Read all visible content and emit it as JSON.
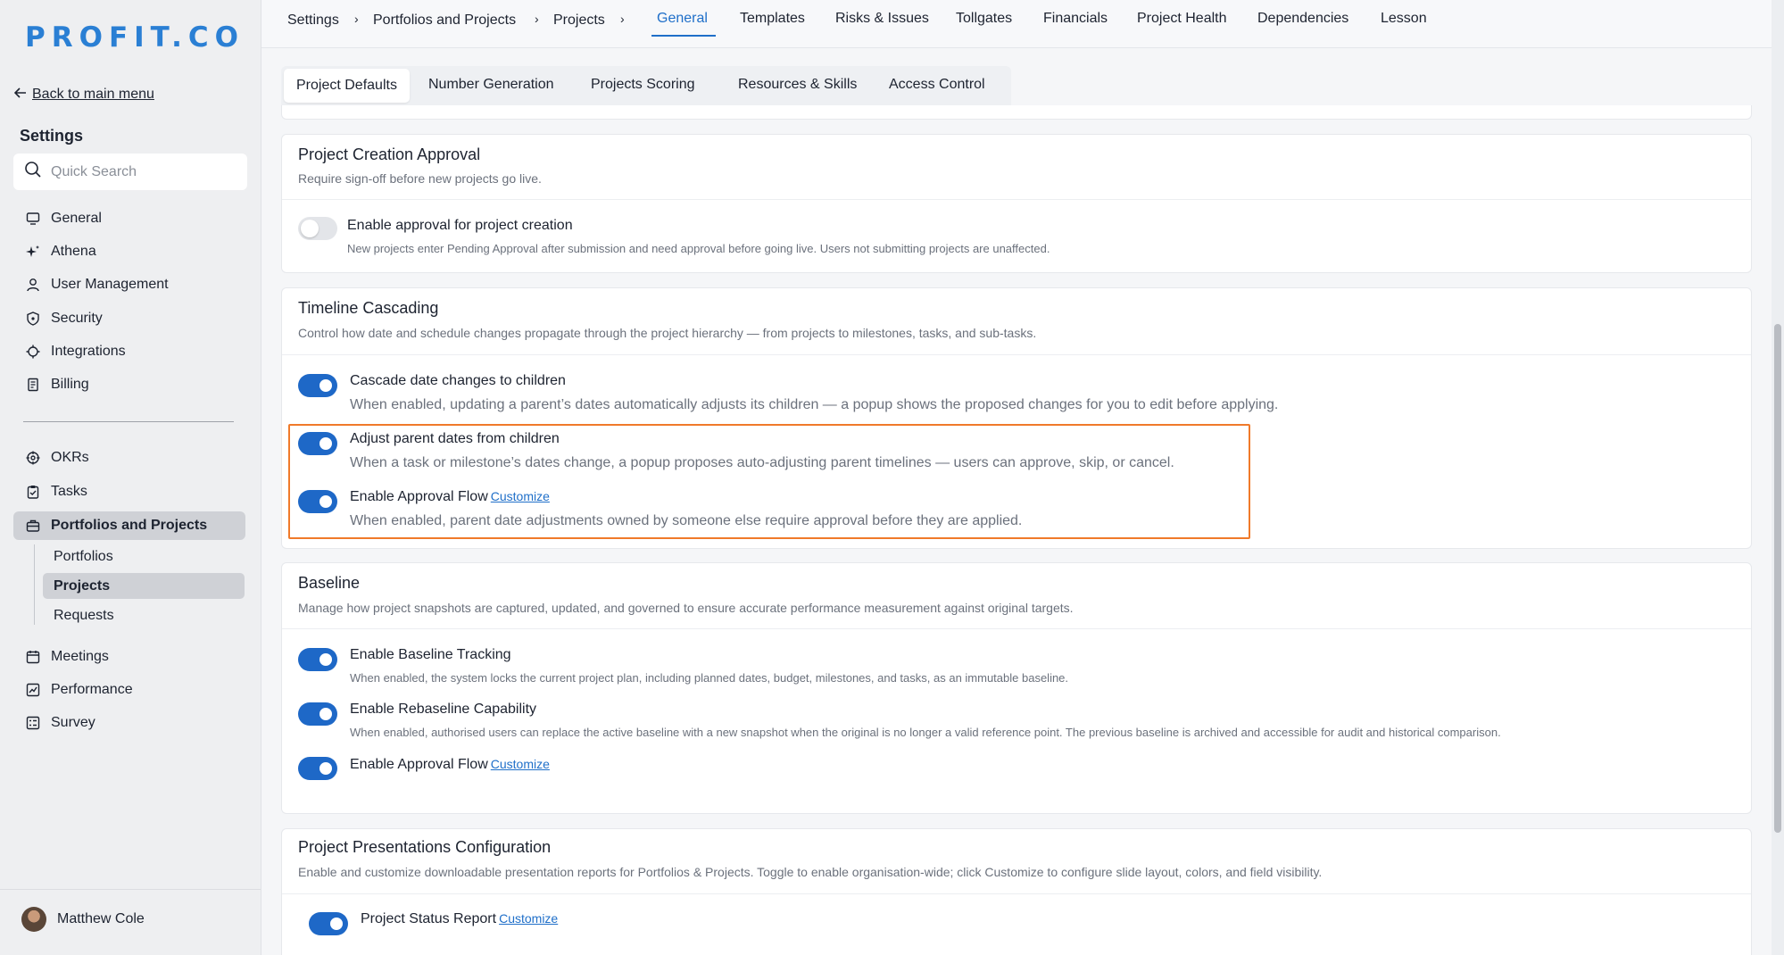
{
  "logo": {
    "text": "PROFIT.CO",
    "color": "#2a7fd4"
  },
  "sidebar": {
    "back_label": "Back to main menu",
    "heading": "Settings",
    "search": {
      "placeholder": "Quick Search",
      "value": ""
    },
    "items_top": [
      {
        "label": "General",
        "icon": "monitor-icon"
      },
      {
        "label": "Athena",
        "icon": "sparkle-icon"
      },
      {
        "label": "User Management",
        "icon": "user-icon"
      },
      {
        "label": "Security",
        "icon": "shield-icon"
      },
      {
        "label": "Integrations",
        "icon": "gear-icon"
      },
      {
        "label": "Billing",
        "icon": "receipt-icon"
      }
    ],
    "items_bottom": [
      {
        "label": "OKRs",
        "icon": "target-icon"
      },
      {
        "label": "Tasks",
        "icon": "clipboard-check-icon"
      },
      {
        "label": "Portfolios and Projects",
        "icon": "briefcase-icon"
      }
    ],
    "sub_items": [
      "Portfolios",
      "Projects",
      "Requests"
    ],
    "items_after": [
      {
        "label": "Meetings",
        "icon": "calendar-icon"
      },
      {
        "label": "Performance",
        "icon": "chart-icon"
      },
      {
        "label": "Survey",
        "icon": "survey-icon"
      }
    ],
    "user_name": "Matthew Cole"
  },
  "breadcrumb": [
    "Settings",
    "Portfolios and Projects",
    "Projects"
  ],
  "top_tabs": [
    "General",
    "Templates",
    "Risks & Issues",
    "Tollgates",
    "Financials",
    "Project Health",
    "Dependencies",
    "Lesson"
  ],
  "sub_tabs": [
    "Project Defaults",
    "Number Generation",
    "Projects Scoring",
    "Resources & Skills",
    "Access Control"
  ],
  "approval": {
    "title": "Project Creation Approval",
    "desc": "Require sign-off before new projects go live.",
    "option_title": "Enable approval for project creation",
    "option_desc": "New projects enter Pending Approval after submission and need approval before going live. Users not submitting projects are unaffected.",
    "enabled": false
  },
  "timeline": {
    "title": "Timeline Cascading",
    "desc": "Control how date and schedule changes propagate through the project hierarchy — from projects to milestones, tasks, and sub-tasks.",
    "options": [
      {
        "title": "Cascade date changes to children",
        "desc": "When enabled, updating a parent’s dates automatically adjusts its children — a popup shows the proposed changes for you to edit before applying.",
        "enabled": true
      },
      {
        "title": "Adjust parent dates from children",
        "desc": "When a task or milestone’s dates change, a popup proposes auto-adjusting parent timelines — users can approve, skip, or cancel.",
        "enabled": true
      },
      {
        "title": "Enable Approval Flow",
        "link": "Customize",
        "desc": "When enabled, parent date adjustments owned by someone else require approval before they are applied.",
        "enabled": true
      }
    ]
  },
  "baseline": {
    "title": "Baseline",
    "desc": "Manage how project snapshots are captured, updated, and governed to ensure accurate performance measurement against original targets.",
    "options": [
      {
        "title": "Enable Baseline Tracking",
        "desc": "When enabled, the system locks the current project plan, including planned dates, budget, milestones, and tasks, as an immutable baseline.",
        "enabled": true
      },
      {
        "title": "Enable Rebaseline Capability",
        "desc": "When enabled, authorised users can replace the active baseline with a new snapshot when the original is no longer a valid reference point. The previous baseline is archived and accessible for audit and historical comparison.",
        "enabled": true
      },
      {
        "title": "Enable Approval Flow",
        "link": "Customize",
        "enabled": true
      }
    ]
  },
  "presentations": {
    "title": "Project Presentations Configuration",
    "desc": "Enable and customize downloadable presentation reports for Portfolios & Projects. Toggle to enable organisation-wide; click Customize to configure slide layout, colors, and field visibility.",
    "options": [
      {
        "title": "Project Status Report",
        "link": "Customize",
        "enabled": true
      }
    ]
  },
  "colors": {
    "accent": "#1f6fc9",
    "toggle_on": "#1e68c7",
    "highlight": "#f07a2a"
  }
}
